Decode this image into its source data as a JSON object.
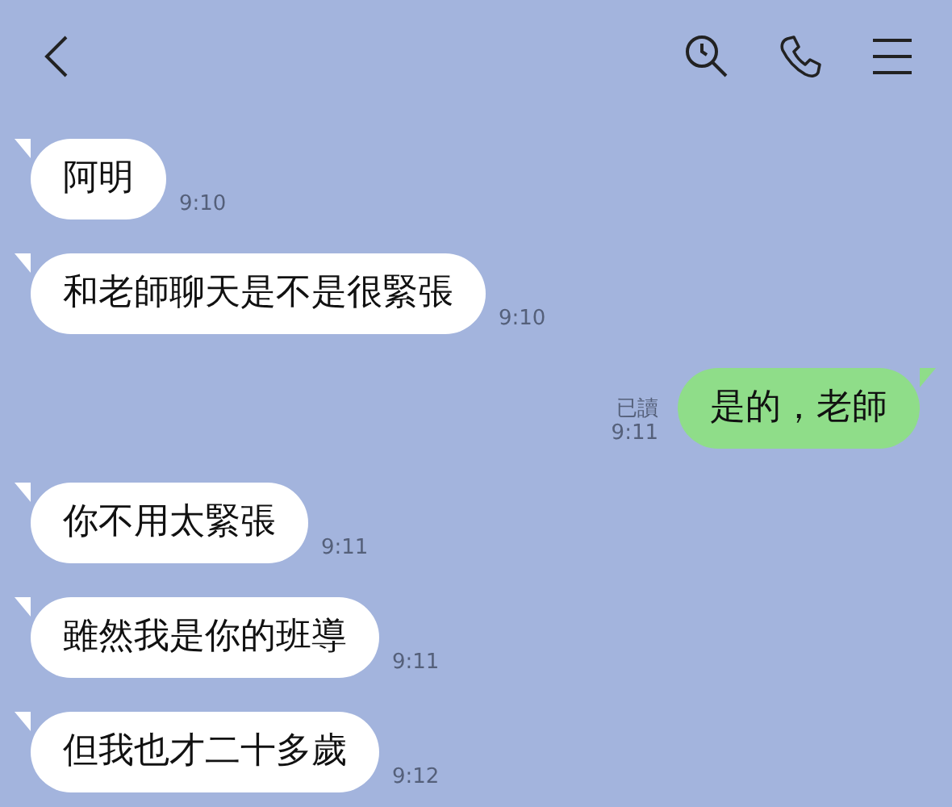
{
  "messages": [
    {
      "kind": "received",
      "text": "阿明",
      "time": "9:10"
    },
    {
      "kind": "received",
      "text": "和老師聊天是不是很緊張",
      "time": "9:10"
    },
    {
      "kind": "sent",
      "text": "是的，老師",
      "time": "9:11",
      "read": "已讀"
    },
    {
      "kind": "received",
      "text": "你不用太緊張",
      "time": "9:11"
    },
    {
      "kind": "received",
      "text": "雖然我是你的班導",
      "time": "9:11"
    },
    {
      "kind": "received",
      "text": "但我也才二十多歲",
      "time": "9:12"
    }
  ]
}
